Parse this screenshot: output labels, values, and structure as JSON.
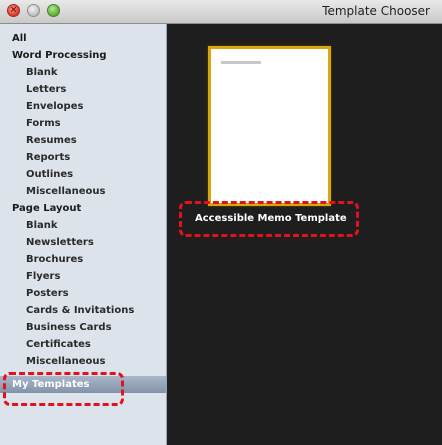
{
  "window": {
    "title": "Template Chooser",
    "close_glyph": "×"
  },
  "sidebar": {
    "items": [
      {
        "label": "All",
        "kind": "heading"
      },
      {
        "label": "Word Processing",
        "kind": "heading"
      },
      {
        "label": "Blank",
        "kind": "sub"
      },
      {
        "label": "Letters",
        "kind": "sub"
      },
      {
        "label": "Envelopes",
        "kind": "sub"
      },
      {
        "label": "Forms",
        "kind": "sub"
      },
      {
        "label": "Resumes",
        "kind": "sub"
      },
      {
        "label": "Reports",
        "kind": "sub"
      },
      {
        "label": "Outlines",
        "kind": "sub"
      },
      {
        "label": "Miscellaneous",
        "kind": "sub"
      },
      {
        "label": "Page Layout",
        "kind": "heading"
      },
      {
        "label": "Blank",
        "kind": "sub"
      },
      {
        "label": "Newsletters",
        "kind": "sub"
      },
      {
        "label": "Brochures",
        "kind": "sub"
      },
      {
        "label": "Flyers",
        "kind": "sub"
      },
      {
        "label": "Posters",
        "kind": "sub"
      },
      {
        "label": "Cards & Invitations",
        "kind": "sub"
      },
      {
        "label": "Business Cards",
        "kind": "sub"
      },
      {
        "label": "Certificates",
        "kind": "sub"
      },
      {
        "label": "Miscellaneous",
        "kind": "sub"
      },
      {
        "label": "My Templates",
        "kind": "heading",
        "selected": true
      }
    ]
  },
  "templates": [
    {
      "label": "Accessible Memo Template",
      "selected": true
    }
  ],
  "colors": {
    "callout": "#e0121e",
    "selection_frame": "#d9a60d",
    "content_background": "#1e1e1e",
    "sidebar_background": "#dde3ea"
  }
}
